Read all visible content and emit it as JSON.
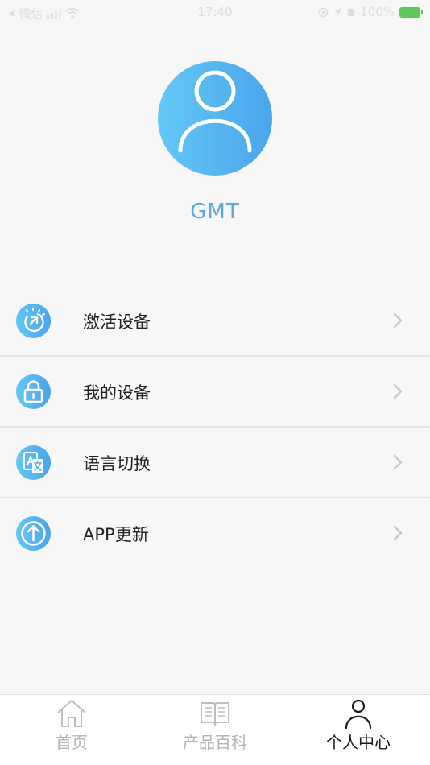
{
  "status_bar": {
    "carrier": "微信",
    "time": "17:40",
    "battery": "100%"
  },
  "profile": {
    "username": "GMT"
  },
  "menu": {
    "items": [
      {
        "label": "激活设备",
        "icon": "activate-device-icon"
      },
      {
        "label": "我的设备",
        "icon": "lock-icon"
      },
      {
        "label": "语言切换",
        "icon": "translate-icon"
      },
      {
        "label": "APP更新",
        "icon": "upload-arrow-icon"
      }
    ]
  },
  "tab_bar": {
    "tabs": [
      {
        "label": "首页",
        "icon": "home-icon",
        "active": false
      },
      {
        "label": "产品百科",
        "icon": "book-icon",
        "active": false
      },
      {
        "label": "个人中心",
        "icon": "person-icon",
        "active": true
      }
    ]
  },
  "colors": {
    "accent_gradient_start": "#63c8f6",
    "accent_gradient_end": "#4aa4ec",
    "username": "#5ea8db",
    "tab_inactive": "#b4b4b4",
    "tab_active": "#1a1a1a"
  }
}
